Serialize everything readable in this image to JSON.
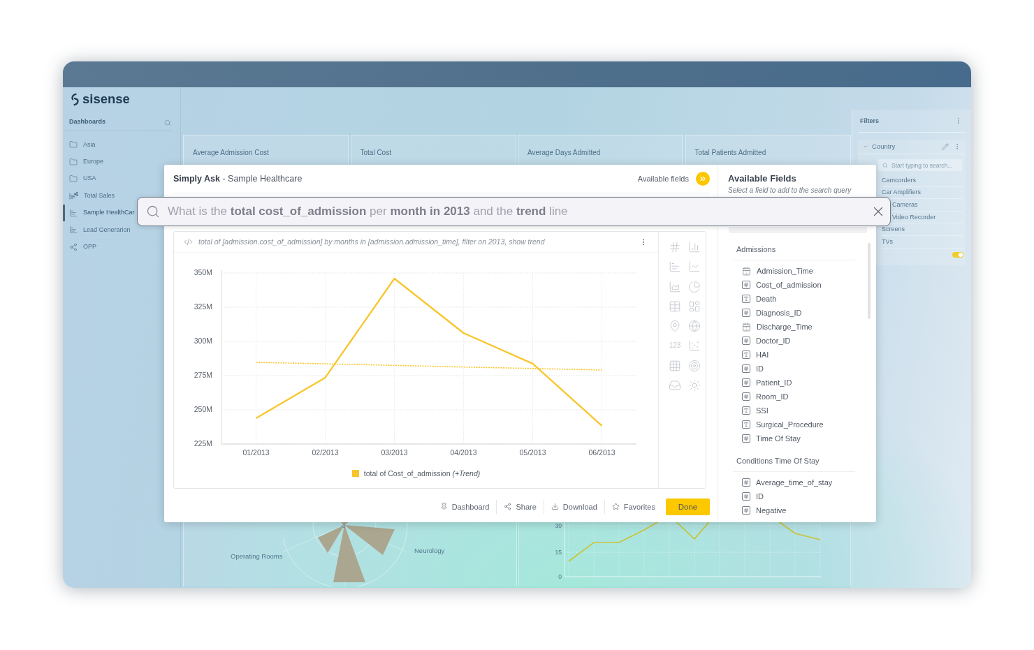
{
  "logo": {
    "text": "sisense"
  },
  "sidebar": {
    "title": "Dashboards",
    "items": [
      {
        "label": "Asia",
        "kind": "folder",
        "selected": false
      },
      {
        "label": "Europe",
        "kind": "folder",
        "selected": false
      },
      {
        "label": "USA",
        "kind": "folder",
        "selected": false
      },
      {
        "label": "Total Sales",
        "kind": "shared_dashboard",
        "selected": false
      },
      {
        "label": "Sample HealthCar",
        "kind": "dashboard",
        "selected": true
      },
      {
        "label": "Lead Generarion",
        "kind": "dashboard",
        "selected": false
      },
      {
        "label": "OPP",
        "kind": "shared",
        "selected": false
      }
    ]
  },
  "kpi_tiles": [
    {
      "title": "Average Admission Cost"
    },
    {
      "title": "Total Cost"
    },
    {
      "title": "Average Days Admitted"
    },
    {
      "title": "Total Patients Admitted"
    }
  ],
  "background_widgets": {
    "polar": {
      "labels": [
        "Operating Rooms",
        "Neurology"
      ],
      "axis_label": "0"
    },
    "trend": {
      "y_ticks": [
        "30",
        "15",
        "0"
      ]
    }
  },
  "filters": {
    "title": "Filters",
    "panels": [
      {
        "field": "Country",
        "expanded": true,
        "search_placeholder": "Start typing to search...",
        "values": [
          "Camcorders",
          "Car Amplifiers",
          "Cameras",
          "Video Recorder",
          "Screens",
          "TVs"
        ],
        "enabled": true
      }
    ]
  },
  "simply_ask": {
    "title": "**Simply Ask** - Sample Healthcare",
    "fields_toggle": "Available fields",
    "query": "What is the **total cost_of_admission** per **month in 2013** and the **trend** line",
    "widget": {
      "query_description": "total of [admission.cost_of_admission] by months in [admission.admission_time], filter on 2013, show trend",
      "chart_data": {
        "type": "line",
        "grid": true,
        "categories": [
          "01/2013",
          "02/2013",
          "03/2013",
          "04/2013",
          "05/2013",
          "06/2013"
        ],
        "series": [
          {
            "name": "total of Cost_of_admission *(+Trend)*",
            "color": "#f8c62c",
            "values": [
              243.9,
              273.5,
              345.9,
              306.1,
              283.7,
              238.3
            ]
          },
          {
            "color": "#f8c62c",
            "line_style": "dotted",
            "values": [
              284.7,
              283.6,
              282.5,
              281.3,
              280.2,
              279.1
            ]
          }
        ],
        "ylim": [
          225,
          350
        ],
        "yticks": [
          {
            "value": 225,
            "label": "225M"
          },
          {
            "value": 250,
            "label": "250M"
          },
          {
            "value": 275,
            "label": "275M"
          },
          {
            "value": 300,
            "label": "300M"
          },
          {
            "value": 325,
            "label": "325M"
          },
          {
            "value": 350,
            "label": "350M"
          }
        ]
      },
      "chart_picker": {
        "indicator_label": "123"
      }
    },
    "actions": [
      {
        "label": "Dashboard",
        "kind": "pin"
      },
      {
        "label": "Share",
        "kind": "share"
      },
      {
        "label": "Download",
        "kind": "download"
      },
      {
        "label": "Favorites",
        "kind": "star"
      }
    ],
    "done_button": "Done"
  },
  "available_fields": {
    "title": "Available Fields",
    "subtitle": "Select a field to add to the search query",
    "groups": [
      {
        "name": "Admissions",
        "fields": [
          {
            "name": "Admission_Time",
            "kind": "date"
          },
          {
            "name": "Cost_of_admission",
            "kind": "number"
          },
          {
            "name": "Death",
            "kind": "text"
          },
          {
            "name": "Diagnosis_ID",
            "kind": "number"
          },
          {
            "name": "Discharge_Time",
            "kind": "date"
          },
          {
            "name": "Doctor_ID",
            "kind": "number"
          },
          {
            "name": "HAI",
            "kind": "text"
          },
          {
            "name": "ID",
            "kind": "number"
          },
          {
            "name": "Patient_ID",
            "kind": "number"
          },
          {
            "name": "Room_ID",
            "kind": "number"
          },
          {
            "name": "SSI",
            "kind": "text"
          },
          {
            "name": "Surgical_Procedure",
            "kind": "text"
          },
          {
            "name": "Time Of Stay",
            "kind": "number"
          }
        ]
      },
      {
        "name": "Conditions Time Of Stay",
        "fields": [
          {
            "name": "Average_time_of_stay",
            "kind": "number"
          },
          {
            "name": "ID",
            "kind": "number"
          },
          {
            "name": "Negative",
            "kind": "number"
          }
        ]
      }
    ]
  }
}
